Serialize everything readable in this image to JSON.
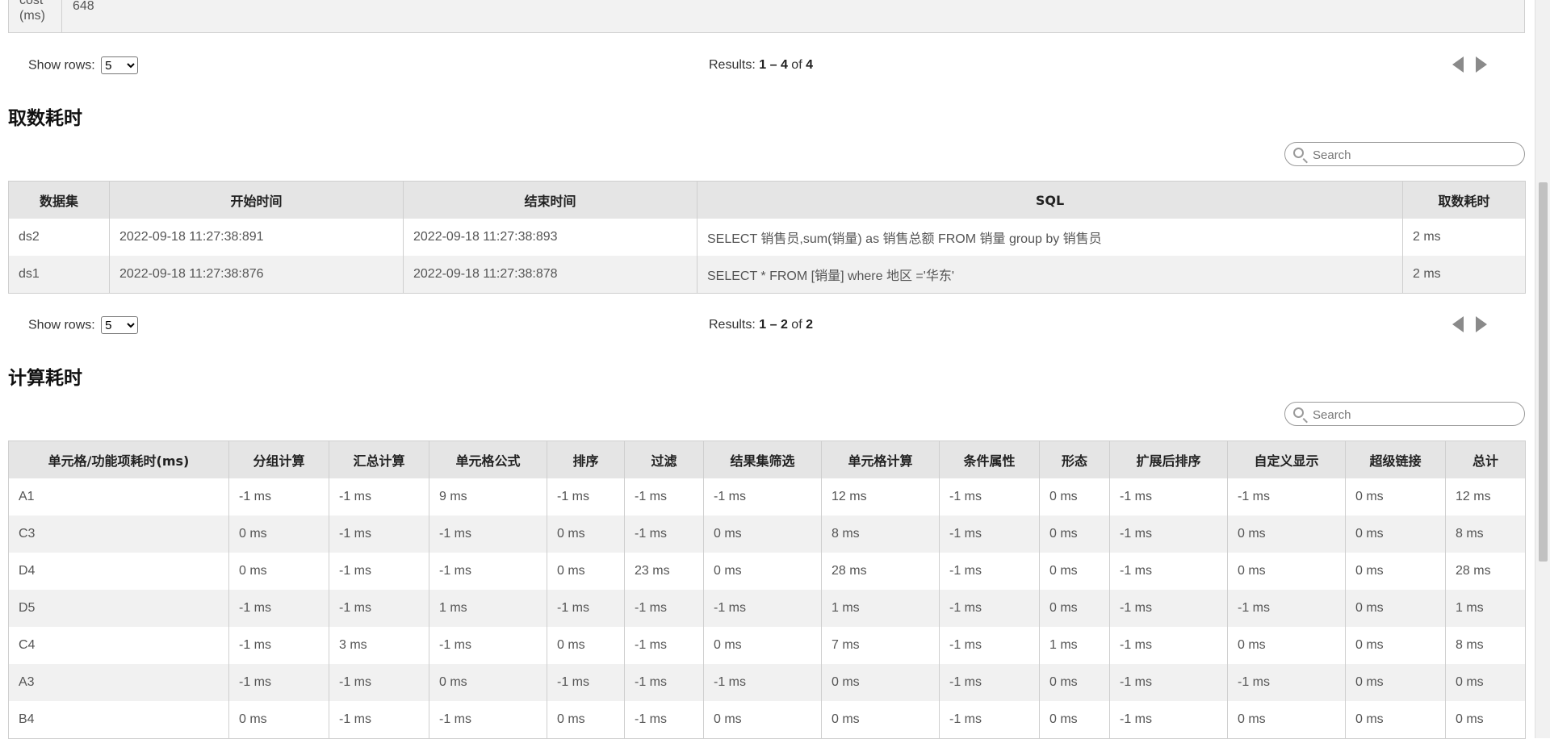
{
  "top_table": {
    "label_lines": [
      "cost",
      "(ms)"
    ],
    "value": "648"
  },
  "pager1": {
    "show_rows": "Show rows:",
    "rows_value": "5",
    "results_prefix": "Results:",
    "range": "1 – 4",
    "of": "of",
    "total": "4"
  },
  "fetch": {
    "title": "取数耗时",
    "search_placeholder": "Search",
    "headers": [
      "数据集",
      "开始时间",
      "结束时间",
      "SQL",
      "取数耗时"
    ],
    "rows": [
      [
        "ds2",
        "2022-09-18 11:27:38:891",
        "2022-09-18 11:27:38:893",
        "SELECT 销售员,sum(销量) as 销售总额 FROM 销量 group by 销售员",
        "2 ms"
      ],
      [
        "ds1",
        "2022-09-18 11:27:38:876",
        "2022-09-18 11:27:38:878",
        "SELECT * FROM [销量] where 地区 ='华东'",
        "2 ms"
      ]
    ]
  },
  "pager2": {
    "show_rows": "Show rows:",
    "rows_value": "5",
    "results_prefix": "Results:",
    "range": "1 – 2",
    "of": "of",
    "total": "2"
  },
  "calc": {
    "title": "计算耗时",
    "search_placeholder": "Search",
    "headers": [
      "单元格/功能项耗时(ms)",
      "分组计算",
      "汇总计算",
      "单元格公式",
      "排序",
      "过滤",
      "结果集筛选",
      "单元格计算",
      "条件属性",
      "形态",
      "扩展后排序",
      "自定义显示",
      "超级链接",
      "总计"
    ],
    "rows": [
      [
        "A1",
        "-1 ms",
        "-1 ms",
        "9 ms",
        "-1 ms",
        "-1 ms",
        "-1 ms",
        "12 ms",
        "-1 ms",
        "0 ms",
        "-1 ms",
        "-1 ms",
        "0 ms",
        "12 ms"
      ],
      [
        "C3",
        "0 ms",
        "-1 ms",
        "-1 ms",
        "0 ms",
        "-1 ms",
        "0 ms",
        "8 ms",
        "-1 ms",
        "0 ms",
        "-1 ms",
        "0 ms",
        "0 ms",
        "8 ms"
      ],
      [
        "D4",
        "0 ms",
        "-1 ms",
        "-1 ms",
        "0 ms",
        "23 ms",
        "0 ms",
        "28 ms",
        "-1 ms",
        "0 ms",
        "-1 ms",
        "0 ms",
        "0 ms",
        "28 ms"
      ],
      [
        "D5",
        "-1 ms",
        "-1 ms",
        "1 ms",
        "-1 ms",
        "-1 ms",
        "-1 ms",
        "1 ms",
        "-1 ms",
        "0 ms",
        "-1 ms",
        "-1 ms",
        "0 ms",
        "1 ms"
      ],
      [
        "C4",
        "-1 ms",
        "3 ms",
        "-1 ms",
        "0 ms",
        "-1 ms",
        "0 ms",
        "7 ms",
        "-1 ms",
        "1 ms",
        "-1 ms",
        "0 ms",
        "0 ms",
        "8 ms"
      ],
      [
        "A3",
        "-1 ms",
        "-1 ms",
        "0 ms",
        "-1 ms",
        "-1 ms",
        "-1 ms",
        "0 ms",
        "-1 ms",
        "0 ms",
        "-1 ms",
        "-1 ms",
        "0 ms",
        "0 ms"
      ],
      [
        "B4",
        "0 ms",
        "-1 ms",
        "-1 ms",
        "0 ms",
        "-1 ms",
        "0 ms",
        "0 ms",
        "-1 ms",
        "0 ms",
        "-1 ms",
        "0 ms",
        "0 ms",
        "0 ms"
      ]
    ]
  }
}
